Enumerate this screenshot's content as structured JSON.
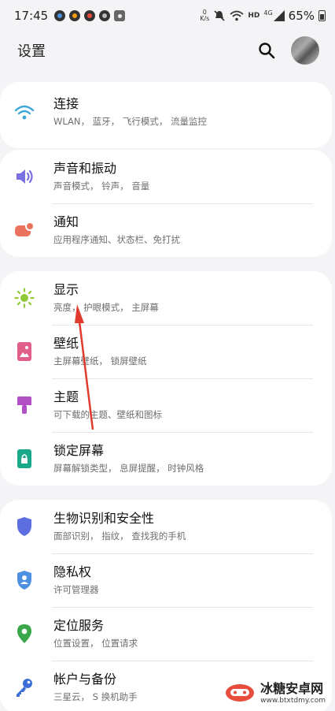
{
  "status_bar": {
    "time": "17:45",
    "net_speed_top": "0",
    "net_speed_bottom": "K/s",
    "hd": "HD",
    "lte": "4G",
    "battery": "65%"
  },
  "header": {
    "title": "设置"
  },
  "groups": [
    {
      "items": [
        {
          "title": "连接",
          "subtitle": "WLAN， 蓝牙， 飞行模式， 流量监控",
          "icon": "wifi-icon",
          "color": "#3fa6d8"
        }
      ]
    },
    {
      "items": [
        {
          "title": "声音和振动",
          "subtitle": "声音模式， 铃声， 音量",
          "icon": "volume-icon",
          "color": "#7a6fe0"
        },
        {
          "title": "通知",
          "subtitle": "应用程序通知、状态栏、免打扰",
          "icon": "notification-icon",
          "color": "#e9735f"
        }
      ]
    },
    {
      "items": [
        {
          "title": "显示",
          "subtitle": "亮度， 护眼模式， 主屏幕",
          "icon": "brightness-icon",
          "color": "#8fc934"
        },
        {
          "title": "壁纸",
          "subtitle": "主屏幕壁纸， 锁屏壁纸",
          "icon": "wallpaper-icon",
          "color": "#e0608a"
        },
        {
          "title": "主题",
          "subtitle": "可下载的主题、壁纸和图标",
          "icon": "theme-brush-icon",
          "color": "#b14fc5"
        },
        {
          "title": "锁定屏幕",
          "subtitle": "屏幕解锁类型， 息屏提醒， 时钟风格",
          "icon": "lock-screen-icon",
          "color": "#1aa88a"
        }
      ]
    },
    {
      "items": [
        {
          "title": "生物识别和安全性",
          "subtitle": "面部识别， 指纹， 查找我的手机",
          "icon": "shield-icon",
          "color": "#5d6ee0"
        },
        {
          "title": "隐私权",
          "subtitle": "许可管理器",
          "icon": "privacy-shield-icon",
          "color": "#4d8fe0"
        },
        {
          "title": "定位服务",
          "subtitle": "位置设置， 位置请求",
          "icon": "location-pin-icon",
          "color": "#3aa84a"
        },
        {
          "title": "帐户与备份",
          "subtitle": "三星云， S 换机助手",
          "icon": "key-icon",
          "color": "#3b6fd6"
        }
      ]
    }
  ],
  "watermark": {
    "text": "冰糖安卓网",
    "url": "www.btxtdmy.com"
  },
  "annotation": {
    "color": "#e03a2f"
  }
}
